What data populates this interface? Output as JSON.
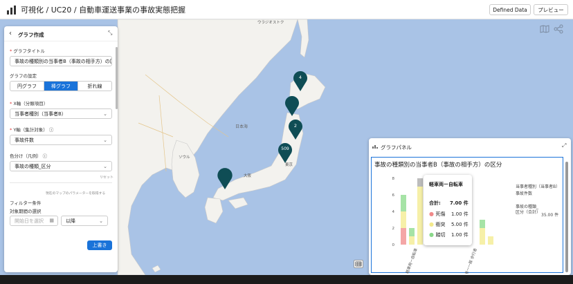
{
  "header": {
    "title": "可視化 / UC20 / 自動車運送事業の事故実態把握",
    "defined_data_label": "Defined Data",
    "preview_label": "プレビュー"
  },
  "graph_create": {
    "title": "グラフ作成",
    "graph_title_label": "グラフタイトル",
    "graph_title_value": "事故の種類別の当事者B（事故の相手方）の区",
    "graph_settings_label": "グラフの設定",
    "types": [
      "円グラフ",
      "棒グラフ",
      "折れ線"
    ],
    "selected_type": "棒グラフ",
    "x_axis_label": "X軸（分類項目）",
    "x_axis_value": "当事者種別（当事者B）",
    "y_axis_label": "Y軸（集計対象）",
    "y_axis_value": "事故件数",
    "color_label": "色分け（凡例）",
    "color_value": "事故の種類_区分",
    "reset_link": "リセット",
    "map_param_link": "現在のマップのパラメーターを取得する",
    "filter_label": "フィルター条件",
    "period_label": "対象期間の選択",
    "start_date_placeholder": "開始日を選択",
    "period_option": "以降",
    "overwrite_label": "上書き"
  },
  "map": {
    "pins": [
      "4",
      "",
      "2",
      "509",
      ""
    ],
    "labels": [
      "日本海",
      "ウラジオストク",
      "ソウル",
      "東京",
      "大阪"
    ],
    "grid_icon": "grid-icon"
  },
  "graph_panel": {
    "title": "グラフパネル",
    "chart_title": "事故の種類別の当事者B（事故の相手方）の区分",
    "info_rows": [
      {
        "label": "当事者種別（当事者B）",
        "value": ""
      },
      {
        "label": "事故件数",
        "value": ""
      },
      {
        "label": "事故の種類_区分（合計）",
        "value": "35.00 件"
      }
    ],
    "tooltip": {
      "title": "軽車両ー自転車",
      "total_label": "合計:",
      "total_value": "7.00 件",
      "rows": [
        {
          "label": "死傷",
          "value": "1.00 件",
          "color": "#f08a8a"
        },
        {
          "label": "衝突",
          "value": "5.00 件",
          "color": "#f3e98c"
        },
        {
          "label": "踏切",
          "value": "1.00 件",
          "color": "#8ad88a"
        }
      ]
    }
  },
  "chart_data": {
    "type": "bar",
    "stacked": true,
    "categories": [
      "軽車両ー自転車",
      "",
      "",
      "",
      "",
      "",
      "",
      "",
      "歩行者ー一般"
    ],
    "series": [
      {
        "name": "死傷",
        "values": [
          2,
          0,
          0,
          1,
          0,
          0,
          0,
          0,
          0
        ]
      },
      {
        "name": "衝突",
        "values": [
          2,
          1,
          7,
          0,
          0,
          0,
          0,
          2,
          1
        ]
      },
      {
        "name": "踏切",
        "values": [
          2,
          1,
          1,
          0,
          0,
          0,
          0,
          1,
          0
        ]
      }
    ],
    "yticks": [
      0,
      2,
      4,
      6,
      8
    ],
    "ylim": [
      0,
      8
    ],
    "xlabels": [
      "軽車両ー自転車",
      "歩行者ー一般 歩行者"
    ],
    "colors": {
      "死傷": "#f4a6a6",
      "衝突": "#f6f0a8",
      "踏切": "#a6e3a6"
    }
  }
}
